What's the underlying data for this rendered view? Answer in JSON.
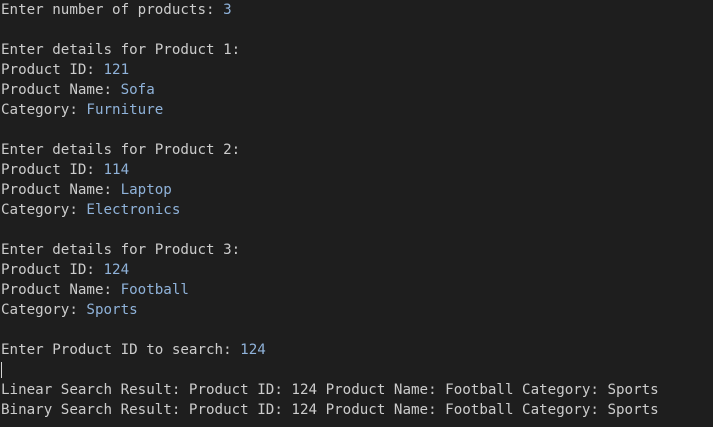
{
  "theme": {
    "background": "#1e1e1e",
    "text_color": "#cccccc",
    "input_color": "#8fb2d9"
  },
  "terminal": {
    "count_prompt": "Enter number of products: ",
    "count_value": "3",
    "products": [
      {
        "header": "Enter details for Product 1:",
        "id_label": "Product ID: ",
        "id_value": "121",
        "name_label": "Product Name: ",
        "name_value": "Sofa",
        "category_label": "Category: ",
        "category_value": "Furniture"
      },
      {
        "header": "Enter details for Product 2:",
        "id_label": "Product ID: ",
        "id_value": "114",
        "name_label": "Product Name: ",
        "name_value": "Laptop",
        "category_label": "Category: ",
        "category_value": "Electronics"
      },
      {
        "header": "Enter details for Product 3:",
        "id_label": "Product ID: ",
        "id_value": "124",
        "name_label": "Product Name: ",
        "name_value": "Football",
        "category_label": "Category: ",
        "category_value": "Sports"
      }
    ],
    "search_prompt": "Enter Product ID to search: ",
    "search_value": "124",
    "linear_result": "Linear Search Result: Product ID: 124 Product Name: Football Category: Sports",
    "binary_result": "Binary Search Result: Product ID: 124 Product Name: Football Category: Sports"
  }
}
